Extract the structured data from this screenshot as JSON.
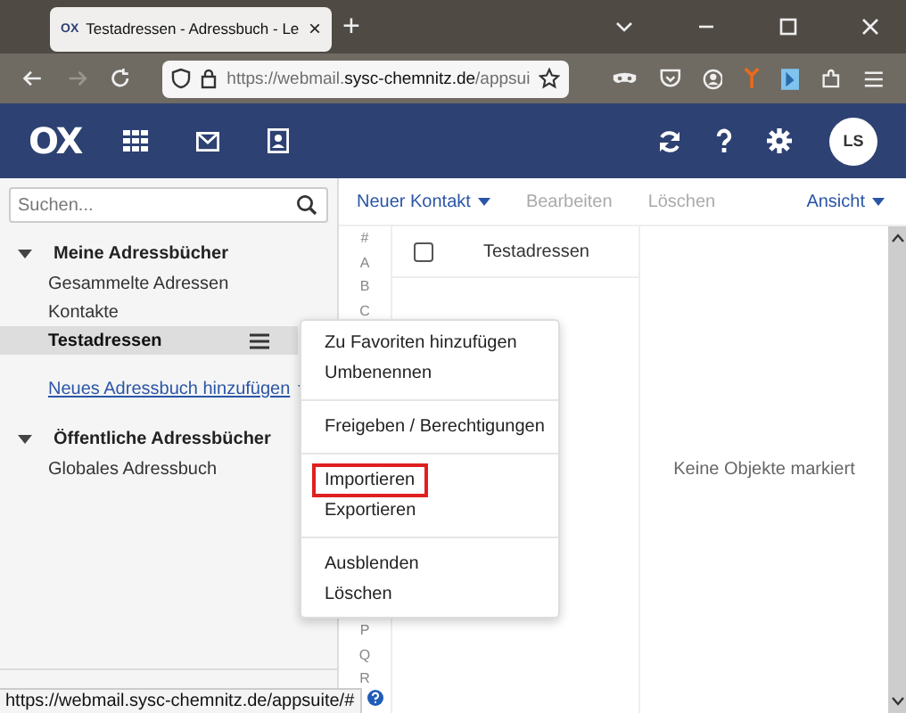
{
  "browser": {
    "tab": {
      "favicon": "OX",
      "title": "Testadressen - Adressbuch - Le",
      "close": "×"
    },
    "new_tab": "+",
    "url": {
      "prefix": "https://webmail.",
      "domain": "sysc-chemnitz.de",
      "path": "/appsui"
    },
    "back_disabled": false,
    "forward_disabled": true
  },
  "header": {
    "logo": "OX",
    "avatar": "LS"
  },
  "search": {
    "placeholder": "Suchen..."
  },
  "tree": [
    {
      "label": "Meine Adressbücher",
      "expanded": true,
      "children": [
        {
          "label": "Gesammelte Adressen",
          "selected": false
        },
        {
          "label": "Kontakte",
          "selected": false
        },
        {
          "label": "Testadressen",
          "selected": true
        }
      ]
    },
    {
      "kind": "link",
      "label": "Neues Adressbuch hinzufügen"
    },
    {
      "label": "Öffentliche Adressbücher",
      "expanded": true,
      "children": [
        {
          "label": "Globales Adressbuch",
          "selected": false
        }
      ]
    }
  ],
  "toolbar": [
    {
      "label": "Neuer Kontakt",
      "disabled": false,
      "dropdown": true
    },
    {
      "label": "Bearbeiten",
      "disabled": true,
      "dropdown": false
    },
    {
      "label": "Löschen",
      "disabled": true,
      "dropdown": false
    },
    {
      "label": "Ansicht",
      "disabled": false,
      "dropdown": true
    }
  ],
  "alphabet": {
    "top": [
      "#",
      "A",
      "B",
      "C"
    ],
    "bottom": [
      "P",
      "Q",
      "R"
    ]
  },
  "list": {
    "title": "Testadressen",
    "select_all": false
  },
  "detail": {
    "message": "Keine Objekte markiert"
  },
  "context_menu": [
    [
      {
        "label": "Zu Favoriten hinzufügen",
        "highlighted": false
      },
      {
        "label": "Umbenennen",
        "highlighted": false
      }
    ],
    [
      {
        "label": "Freigeben / Berechtigungen",
        "highlighted": false
      }
    ],
    [
      {
        "label": "Importieren",
        "highlighted": true
      },
      {
        "label": "Exportieren",
        "highlighted": false
      }
    ],
    [
      {
        "label": "Ausblenden",
        "highlighted": false
      },
      {
        "label": "Löschen",
        "highlighted": false
      }
    ]
  ],
  "status_bar": {
    "url": "https://webmail.sysc-chemnitz.de/appsuite/#"
  }
}
